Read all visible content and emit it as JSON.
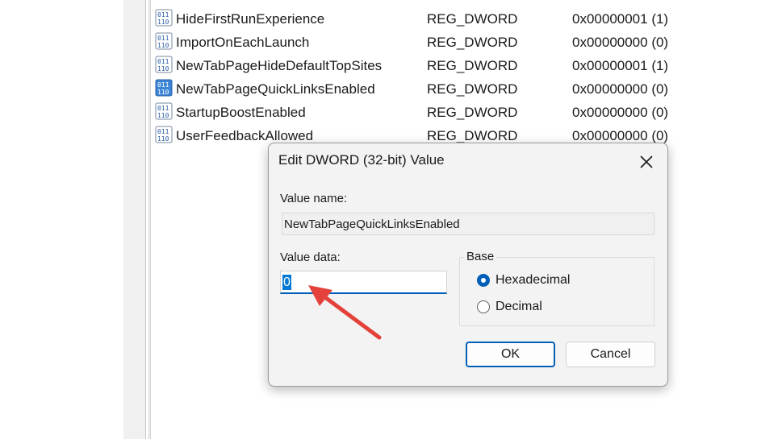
{
  "registry_values": [
    {
      "name": "HideFirstRunExperience",
      "type": "REG_DWORD",
      "data": "0x00000001 (1)",
      "selected": false
    },
    {
      "name": "ImportOnEachLaunch",
      "type": "REG_DWORD",
      "data": "0x00000000 (0)",
      "selected": false
    },
    {
      "name": "NewTabPageHideDefaultTopSites",
      "type": "REG_DWORD",
      "data": "0x00000001 (1)",
      "selected": false
    },
    {
      "name": "NewTabPageQuickLinksEnabled",
      "type": "REG_DWORD",
      "data": "0x00000000 (0)",
      "selected": true
    },
    {
      "name": "StartupBoostEnabled",
      "type": "REG_DWORD",
      "data": "0x00000000 (0)",
      "selected": false
    },
    {
      "name": "UserFeedbackAllowed",
      "type": "REG_DWORD",
      "data": "0x00000000 (0)",
      "selected": false
    }
  ],
  "dialog": {
    "title": "Edit DWORD (32-bit) Value",
    "value_name_label": "Value name:",
    "value_name": "NewTabPageQuickLinksEnabled",
    "value_data_label": "Value data:",
    "value_data": "0",
    "base_label": "Base",
    "base_options": [
      {
        "label": "Hexadecimal",
        "checked": true
      },
      {
        "label": "Decimal",
        "checked": false
      }
    ],
    "ok_label": "OK",
    "cancel_label": "Cancel"
  },
  "icons": {
    "registry_value": "binary-value-icon",
    "close": "close-icon",
    "annotation": "red-arrow-annotation"
  },
  "colors": {
    "accent": "#005fb8",
    "selection": "#0078d4",
    "annotation": "#e5413b"
  }
}
